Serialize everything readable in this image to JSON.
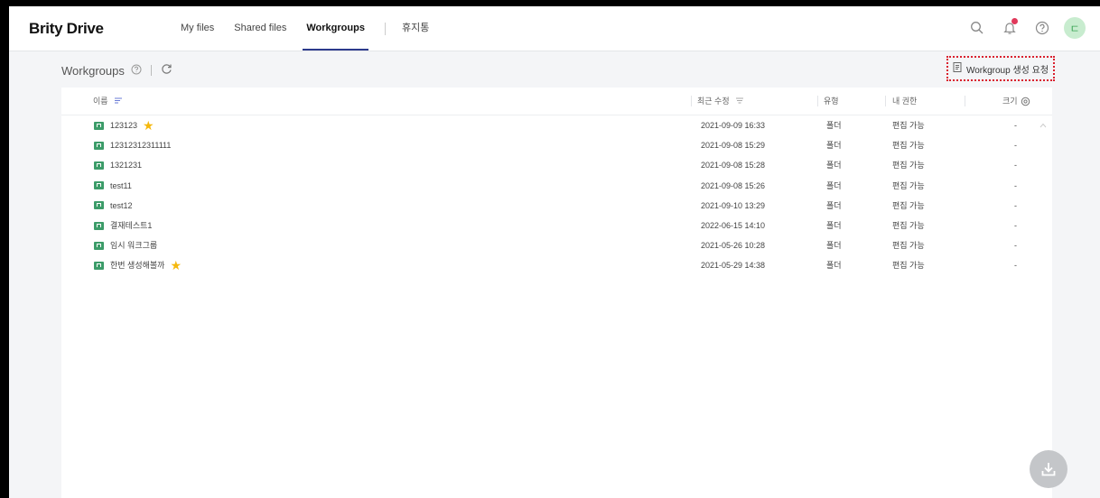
{
  "app": {
    "logo": "Brity Drive"
  },
  "nav": [
    {
      "label": "My files"
    },
    {
      "label": "Shared files"
    },
    {
      "label": "Workgroups",
      "active": true
    },
    {
      "label": "휴지통"
    }
  ],
  "header_icons": [
    "search-icon",
    "bell-icon",
    "help-icon"
  ],
  "avatar": {
    "initial": "ㄷ"
  },
  "subheader": {
    "title": "Workgroups"
  },
  "request_button": {
    "label": "Workgroup 생성 요청"
  },
  "table": {
    "columns": {
      "name": "이름",
      "modified": "최근 수정",
      "type": "유형",
      "permission": "내 권한",
      "size": "크기"
    },
    "rows": [
      {
        "name": "123123",
        "starred": true,
        "modified": "2021-09-09 16:33",
        "type": "폴더",
        "permission": "편집 가능",
        "size": "-"
      },
      {
        "name": "12312312311111",
        "starred": false,
        "modified": "2021-09-08 15:29",
        "type": "폴더",
        "permission": "편집 가능",
        "size": "-"
      },
      {
        "name": "1321231",
        "starred": false,
        "modified": "2021-09-08 15:28",
        "type": "폴더",
        "permission": "편집 가능",
        "size": "-"
      },
      {
        "name": "test11",
        "starred": false,
        "modified": "2021-09-08 15:26",
        "type": "폴더",
        "permission": "편집 가능",
        "size": "-"
      },
      {
        "name": "test12",
        "starred": false,
        "modified": "2021-09-10 13:29",
        "type": "폴더",
        "permission": "편집 가능",
        "size": "-"
      },
      {
        "name": "결재테스트1",
        "starred": false,
        "modified": "2022-06-15 14:10",
        "type": "폴더",
        "permission": "편집 가능",
        "size": "-"
      },
      {
        "name": "임시 워크그룹",
        "starred": false,
        "modified": "2021-05-26 10:28",
        "type": "폴더",
        "permission": "편집 가능",
        "size": "-"
      },
      {
        "name": "한번 생성해볼까",
        "starred": true,
        "modified": "2021-05-29 14:38",
        "type": "폴더",
        "permission": "편집 가능",
        "size": "-"
      }
    ]
  },
  "colors": {
    "accent": "#2c3a8c",
    "star": "#f5b80d",
    "workgroup_icon": "#3c9c69",
    "request_border": "#d9202e"
  }
}
